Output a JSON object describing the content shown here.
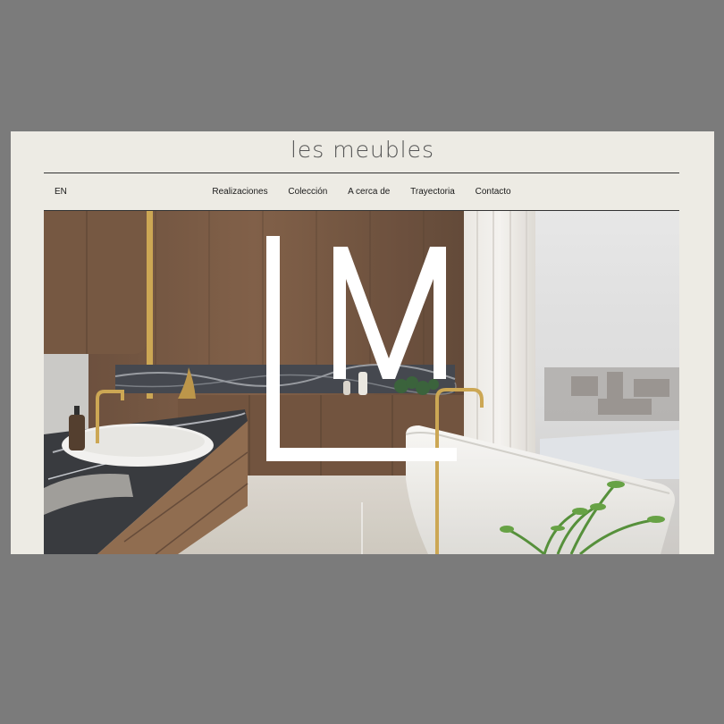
{
  "site": {
    "brand": "les meubles"
  },
  "nav": {
    "language": "EN",
    "items": [
      {
        "label": "Realizaciones"
      },
      {
        "label": "Colección"
      },
      {
        "label": "A cerca de"
      },
      {
        "label": "Trayectoria"
      },
      {
        "label": "Contacto"
      }
    ]
  },
  "hero": {
    "logo_icon": "lm-monogram-icon",
    "scroll_indicator_icon": "scroll-line-icon",
    "colors": {
      "wood": "#6b4a33",
      "brass": "#c9a24a",
      "wall": "#edebe4"
    }
  }
}
